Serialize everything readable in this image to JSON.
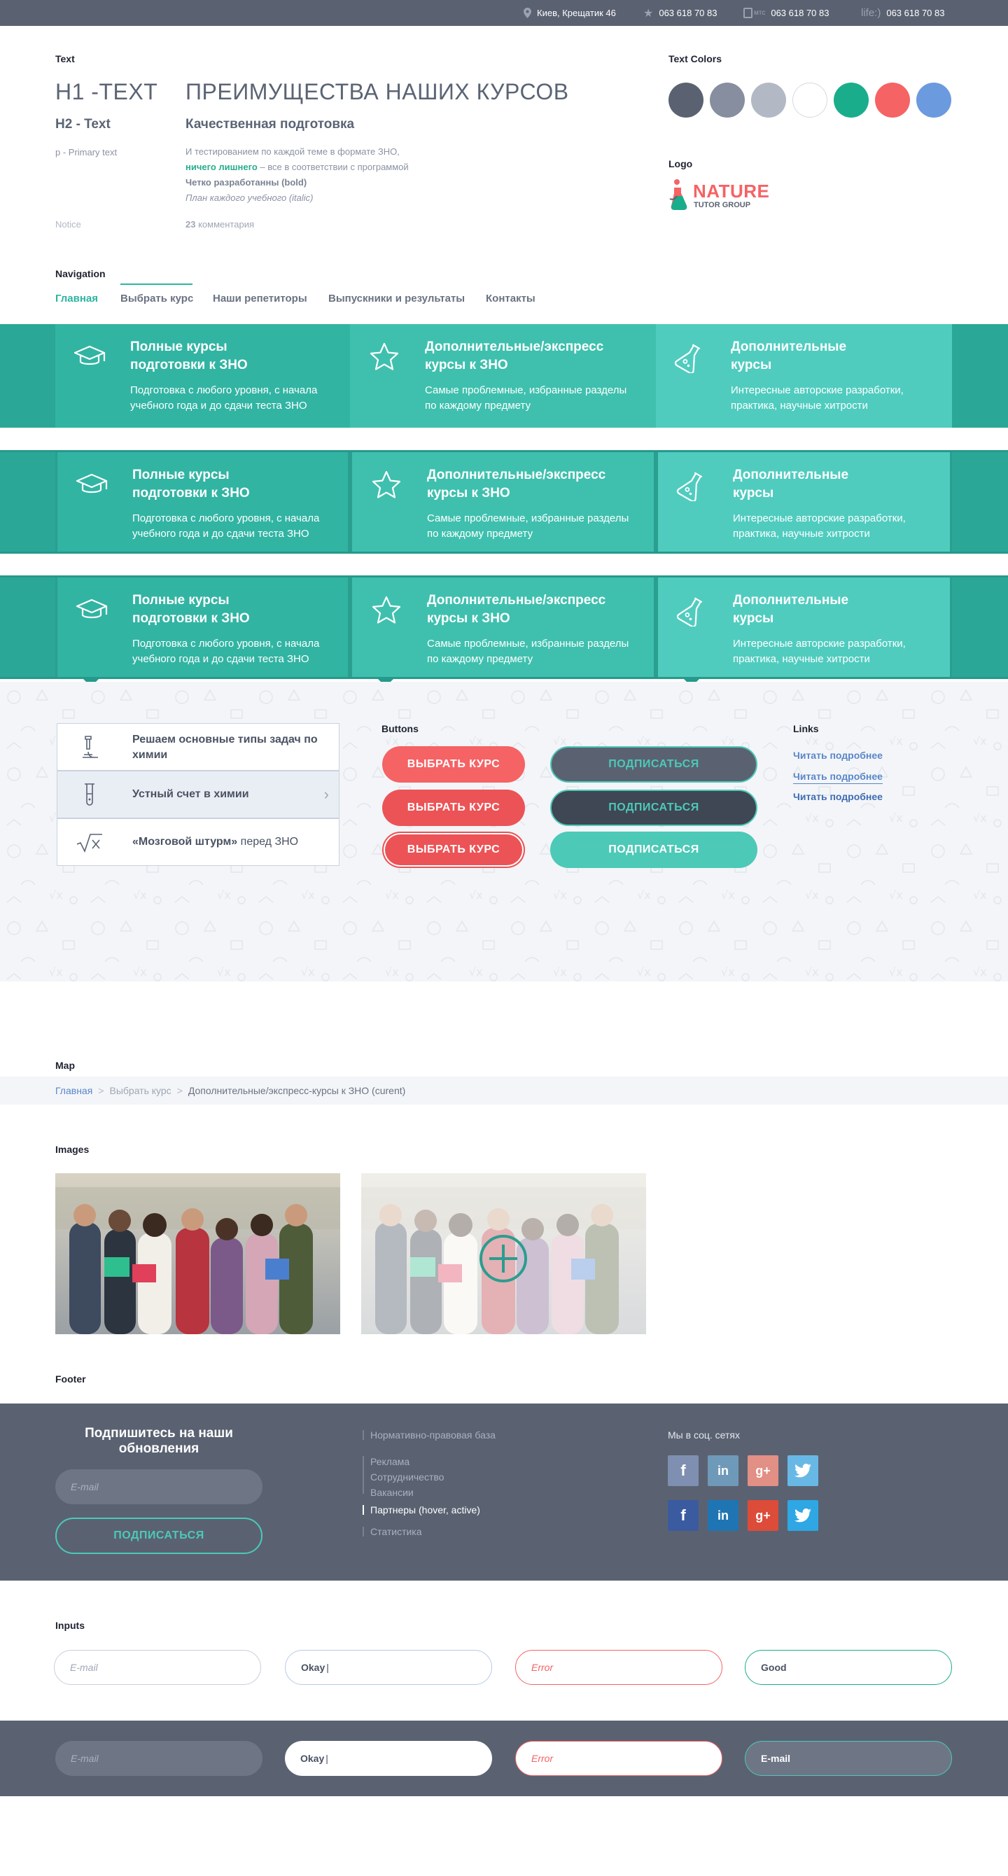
{
  "topbar": {
    "address": "Киев, Крещатик 46",
    "phones": [
      {
        "operator": "",
        "number": "063 618 70 83"
      },
      {
        "operator": "мтс",
        "number": "063 618 70 83"
      },
      {
        "operator": "life:)",
        "number": "063 618 70 83"
      }
    ]
  },
  "text_section": {
    "title": "Text",
    "h1_label": "H1 -TEXT",
    "h1_sample": "ПРЕИМУЩЕСТВА НАШИХ КУРСОВ",
    "h2_label": "H2 - Text",
    "h2_sample": "Качественная подготовка",
    "p_label": "p - Primary text",
    "p_line1": "И тестированием по каждой теме в формате ЗНО,",
    "p_line2_green": "ничего лишнего",
    "p_line2_rest": " – все в соответствии с программой",
    "p_line3": "Четко разработанны (bold)",
    "p_line4": "План каждого учебного (italic)",
    "notice_label": "Notice",
    "notice_num": "23",
    "notice_text": " комментария"
  },
  "text_colors": {
    "title": "Text Colors",
    "colors": [
      "#5a6272",
      "#868ea0",
      "#b2b8c4",
      "#ffffff",
      "#1aad8c",
      "#f56365",
      "#6b9ade"
    ]
  },
  "logo": {
    "title": "Logo",
    "name": "NATURE",
    "sub": "TUTOR GROUP"
  },
  "navigation": {
    "title": "Navigation",
    "items": [
      "Главная",
      "Выбрать курс",
      "Наши репетиторы",
      "Выпускники и результаты",
      "Контакты"
    ]
  },
  "features": [
    {
      "title": "Полные курсы подготовки к ЗНО",
      "desc": "Подготовка с любого уровня, с начала учебного года и до сдачи теста ЗНО",
      "icon": "graduation-cap-icon"
    },
    {
      "title": "Дополнительные/экспресс курсы к ЗНО",
      "desc": "Самые проблемные, избранные разделы по каждому предмету",
      "icon": "star-icon"
    },
    {
      "title": "Дополнительные курсы",
      "desc": "Интересные авторские разработки, практика, научные хитрости",
      "icon": "flask-icon"
    }
  ],
  "list_box": [
    {
      "text": "Решаем основные типы задач по химии",
      "icon": "microscope-icon"
    },
    {
      "text": "Устный счет в химии",
      "icon": "test-tube-icon"
    },
    {
      "bold": "«Мозговой штурм»",
      "rest": " перед ЗНО",
      "icon": "sqrt-icon"
    }
  ],
  "buttons": {
    "title": "Buttons",
    "primary": "ВЫБРАТЬ КУРС",
    "secondary": "ПОДПИСАТЬСЯ"
  },
  "links": {
    "title": "Links",
    "items": [
      "Читать подробнее",
      "Читать подробнее",
      "Читать подробнее"
    ]
  },
  "map": {
    "title": "Map",
    "crumbs": [
      "Главная",
      "Выбрать курс",
      "Дополнительные/экспресс-курсы к ЗНО (curent)"
    ]
  },
  "images": {
    "title": "Images"
  },
  "footer": {
    "title": "Footer",
    "subscribe_title": "Подпишитесь на наши обновления",
    "email_placeholder": "E-mail",
    "subscribe_button": "ПОДПИСАТЬСЯ",
    "links": [
      "Нормативно-правовая база",
      "Реклама",
      "Сотрудничество",
      "Вакансии",
      "Партнеры (hover, active)",
      "Статистика"
    ],
    "social_title": "Мы в соц. сетях"
  },
  "inputs": {
    "title": "Inputs",
    "placeholder": "E-mail",
    "okay": "Okay",
    "error": "Error",
    "good": "Good",
    "dark_email": "E-mail"
  }
}
